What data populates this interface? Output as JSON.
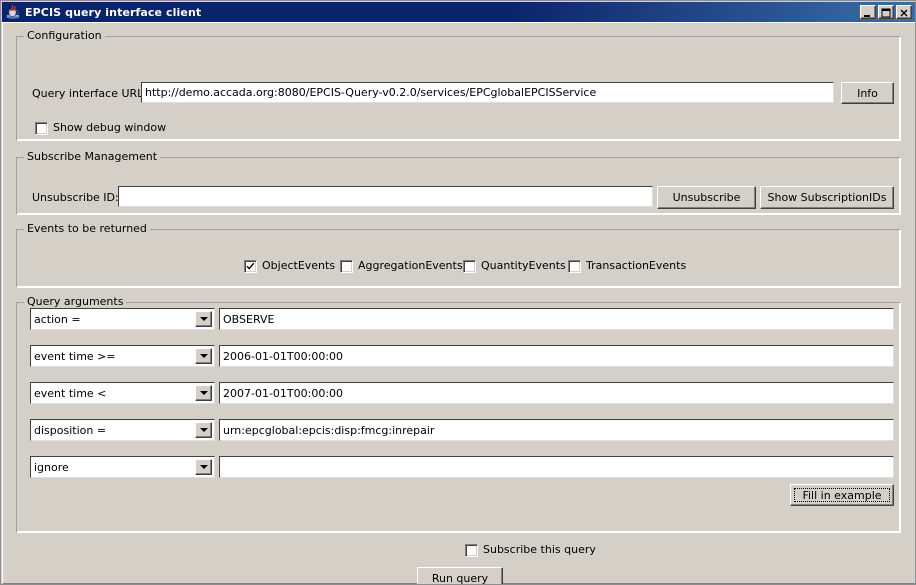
{
  "window": {
    "title": "EPCIS query interface client",
    "icon": "java-cup-icon",
    "minimize_label": "_",
    "maximize_label": "□",
    "close_label": "✕"
  },
  "configuration": {
    "group_title": "Configuration",
    "url_label": "Query interface URL:",
    "url_value": "http://demo.accada.org:8080/EPCIS-Query-v0.2.0/services/EPCglobalEPCISService",
    "url_placeholder": "",
    "info_button": "Info",
    "debug_checkbox": {
      "label": "Show debug window",
      "checked": false
    }
  },
  "subscribe_management": {
    "group_title": "Subscribe Management",
    "unsubscribe_label": "Unsubscribe ID:",
    "unsubscribe_value": "",
    "unsubscribe_placeholder": "",
    "unsubscribe_button": "Unsubscribe",
    "show_ids_button": "Show SubscriptionIDs"
  },
  "events": {
    "group_title": "Events to be returned",
    "checkboxes": [
      {
        "label": "ObjectEvents",
        "checked": true
      },
      {
        "label": "AggregationEvents",
        "checked": false
      },
      {
        "label": "QuantityEvents",
        "checked": false
      },
      {
        "label": "TransactionEvents",
        "checked": false
      }
    ]
  },
  "query_arguments": {
    "group_title": "Query arguments",
    "rows": [
      {
        "select": "action =",
        "value": "OBSERVE"
      },
      {
        "select": "event time >=",
        "value": "2006-01-01T00:00:00"
      },
      {
        "select": "event time <",
        "value": "2007-01-01T00:00:00"
      },
      {
        "select": "disposition =",
        "value": "urn:epcglobal:epcis:disp:fmcg:inrepair"
      },
      {
        "select": "ignore",
        "value": ""
      }
    ],
    "fill_example_button": "Fill in example"
  },
  "footer": {
    "subscribe_checkbox": {
      "label": "Subscribe this query",
      "checked": false
    },
    "run_button": "Run query"
  },
  "colors": {
    "face": "#d4d0c8",
    "title_active": "#0a246a",
    "field_bg": "#ffffff",
    "text": "#000000"
  }
}
